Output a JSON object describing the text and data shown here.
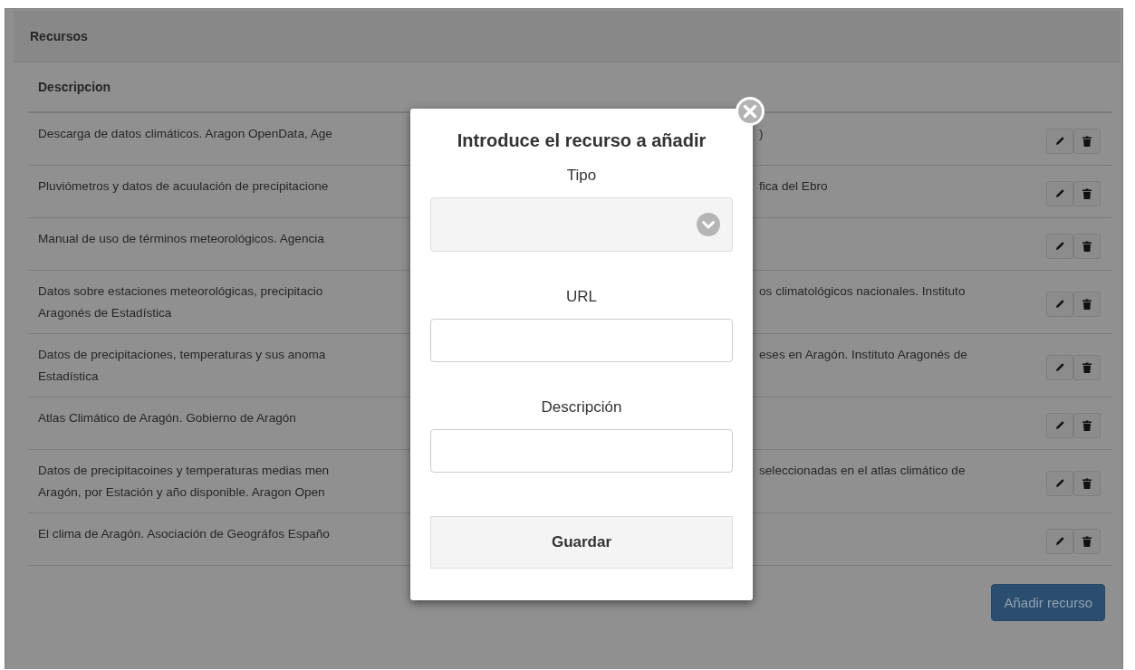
{
  "panel": {
    "title": "Recursos",
    "column": "Descripcion",
    "rows": [
      {
        "left": [
          "Descarga de datos climáticos. Aragon OpenData, Age"
        ],
        "right": [
          ")"
        ]
      },
      {
        "left": [
          "Pluviómetros y datos de acuulación de precipitacione"
        ],
        "right": [
          "fica del Ebro"
        ]
      },
      {
        "left": [
          "Manual de uso de términos meteorológicos. Agencia"
        ],
        "right": []
      },
      {
        "left": [
          "Datos sobre estaciones meteorológicas, precipitacio",
          "Aragonés de Estadística"
        ],
        "right": [
          "os climatológicos nacionales. Instituto"
        ]
      },
      {
        "left": [
          "Datos de precipitaciones, temperaturas y sus anoma",
          "Estadística"
        ],
        "right": [
          "eses en Aragón. Instituto Aragonés de"
        ]
      },
      {
        "left": [
          "Atlas Climático de Aragón. Gobierno de Aragón"
        ],
        "right": []
      },
      {
        "left": [
          "Datos de precipitacoines y temperaturas medias men",
          "Aragón, por Estación y año disponible. Aragon Open"
        ],
        "right": [
          "seleccionadas en el atlas climático de"
        ]
      },
      {
        "left": [
          "El clima de Aragón. Asociación de Geográfos Españo"
        ],
        "right": []
      }
    ],
    "add_button": "Añadir recurso"
  },
  "modal": {
    "title": "Introduce el recurso a añadir",
    "fields": [
      {
        "label": "Tipo",
        "kind": "select"
      },
      {
        "label": "URL",
        "kind": "text"
      },
      {
        "label": "Descripción",
        "kind": "text"
      }
    ],
    "submit": "Guardar"
  }
}
